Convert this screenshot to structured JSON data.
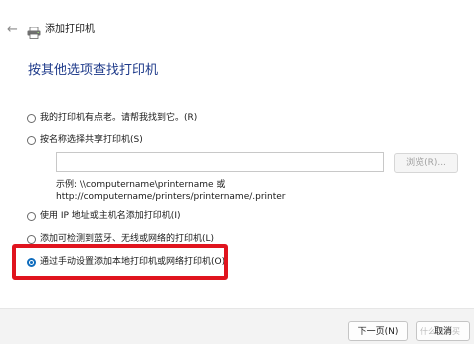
{
  "window": {
    "title": "添加打印机",
    "back_icon": "back-arrow-icon",
    "app_icon": "printer-icon"
  },
  "heading": "按其他选项查找打印机",
  "options": [
    {
      "label": "我的打印机有点老。请帮我找到它。(R)",
      "checked": false
    },
    {
      "label": "按名称选择共享打印机(S)",
      "checked": false
    },
    {
      "label": "使用 IP 地址或主机名添加打印机(I)",
      "checked": false
    },
    {
      "label": "添加可检测到蓝牙、无线或网络的打印机(L)",
      "checked": false
    },
    {
      "label": "通过手动设置添加本地打印机或网络打印机(O)",
      "checked": true
    }
  ],
  "share": {
    "input_value": "",
    "browse_label": "浏览(R)...",
    "example_line1": "示例: \\\\computername\\printername 或",
    "example_line2": "http://computername/printers/printername/.printer"
  },
  "footer": {
    "next_label": "下一页(N)",
    "cancel_label": "取消"
  },
  "watermark": "什么值得买",
  "colors": {
    "heading": "#1e3a8a",
    "accent": "#0f6cbd",
    "highlight": "#e0141e"
  }
}
